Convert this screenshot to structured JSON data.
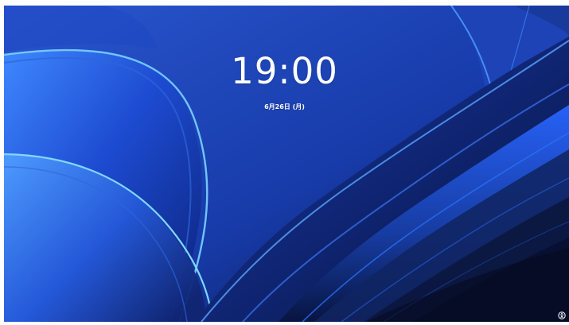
{
  "lock_screen": {
    "time": "19:00",
    "date": "6月26日 (月)"
  },
  "wallpaper": {
    "colors": {
      "background": "#1d3ca8",
      "deep_navy": "#0a1545",
      "bright_blue": "#3b7df0",
      "highlight": "#79c8ff"
    }
  },
  "icons": {
    "accessibility": "accessibility-icon"
  }
}
